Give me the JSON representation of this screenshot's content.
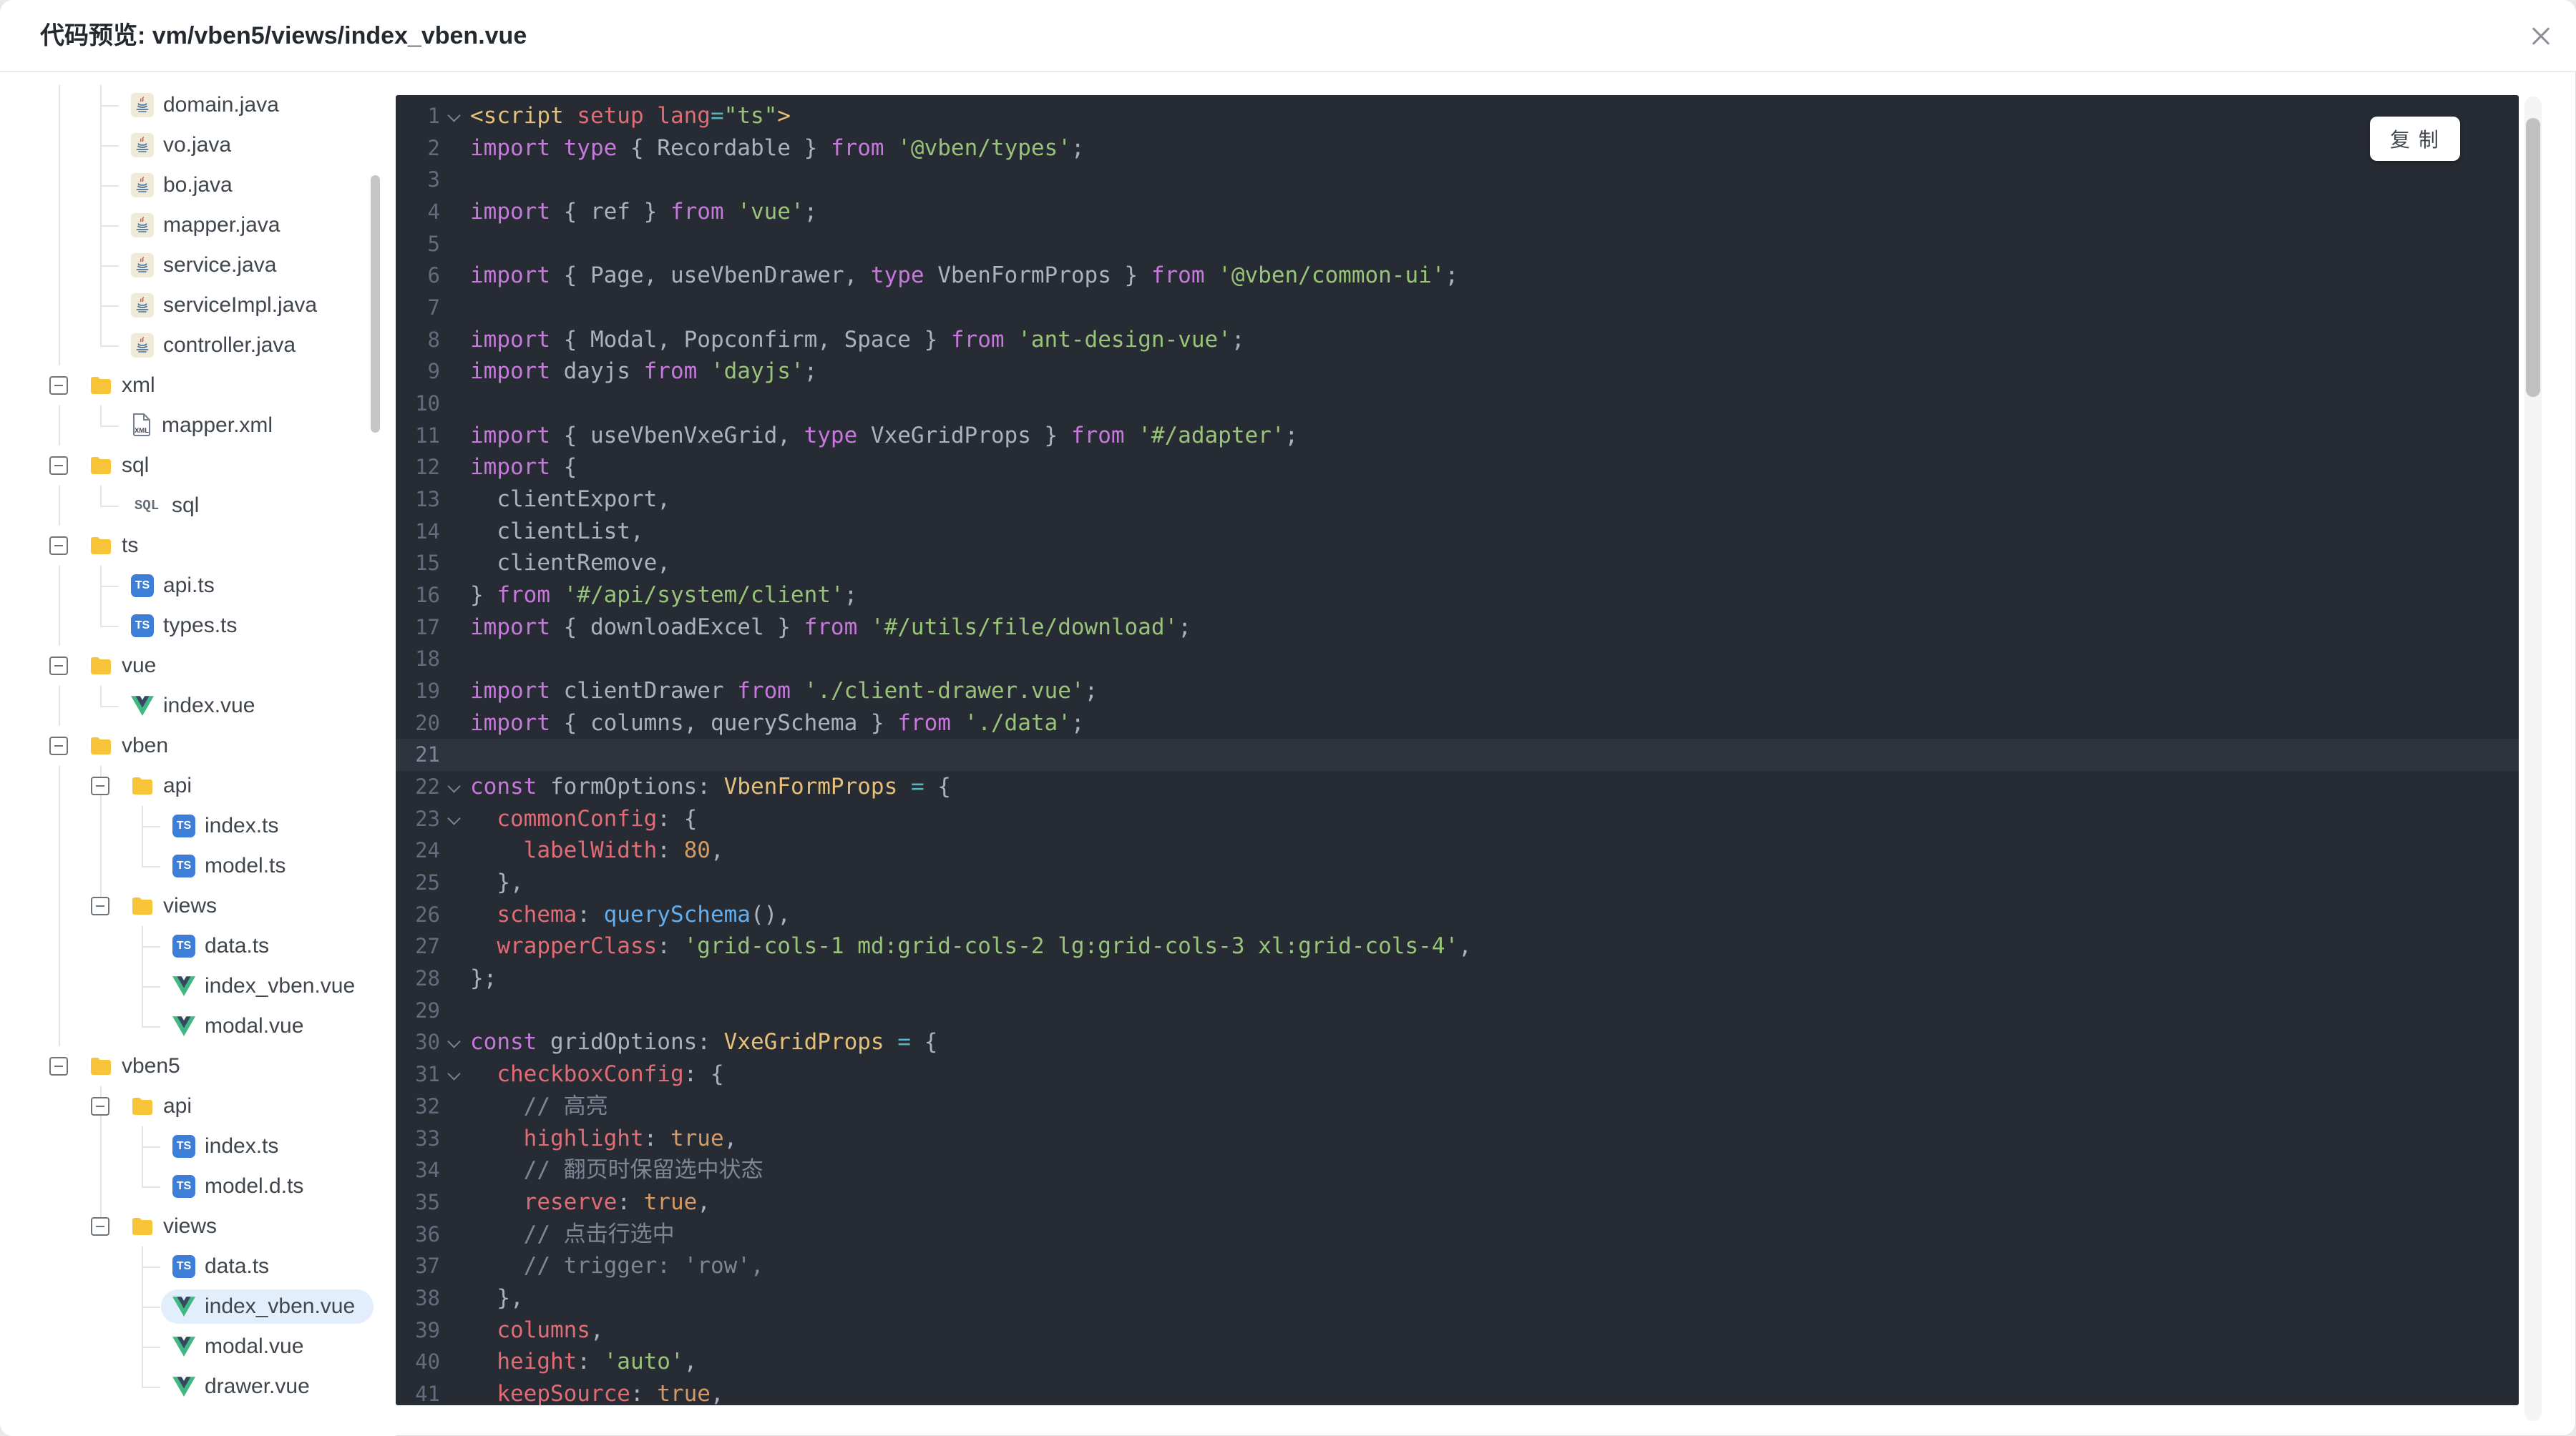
{
  "window": {
    "title": "代码预览: vm/vben5/views/index_vben.vue"
  },
  "toolbar": {
    "copy_label": "复 制"
  },
  "colors": {
    "code_background": "#272b33",
    "active_line": "#2f333d",
    "keyword": "#c678dd",
    "string": "#98c379",
    "type": "#e5c07b",
    "property": "#e06c75",
    "number_bool": "#d19a66",
    "operator": "#56b6c2",
    "function": "#61afef",
    "comment": "#7d8694",
    "foreground": "#abb2bf",
    "selected_item_bg": "#e2eefb",
    "folder_icon": "#f8c53a",
    "ts_icon_bg": "#3d7ed8",
    "vue_icon_green": "#41b883",
    "vue_icon_dark": "#35495e"
  },
  "sidebar": {
    "tree": [
      {
        "label": "domain.java",
        "icon": "java",
        "depth": 1,
        "expander": false,
        "elbow": "mid",
        "tick": true,
        "guides": [
          0
        ],
        "selected": false
      },
      {
        "label": "vo.java",
        "icon": "java",
        "depth": 1,
        "expander": false,
        "elbow": "mid",
        "tick": true,
        "guides": [
          0
        ],
        "selected": false
      },
      {
        "label": "bo.java",
        "icon": "java",
        "depth": 1,
        "expander": false,
        "elbow": "mid",
        "tick": true,
        "guides": [
          0
        ],
        "selected": false
      },
      {
        "label": "mapper.java",
        "icon": "java",
        "depth": 1,
        "expander": false,
        "elbow": "mid",
        "tick": true,
        "guides": [
          0
        ],
        "selected": false
      },
      {
        "label": "service.java",
        "icon": "java",
        "depth": 1,
        "expander": false,
        "elbow": "mid",
        "tick": true,
        "guides": [
          0
        ],
        "selected": false
      },
      {
        "label": "serviceImpl.java",
        "icon": "java",
        "depth": 1,
        "expander": false,
        "elbow": "mid",
        "tick": true,
        "guides": [
          0
        ],
        "selected": false
      },
      {
        "label": "controller.java",
        "icon": "java",
        "depth": 1,
        "expander": false,
        "elbow": "end",
        "tick": true,
        "guides": [
          0
        ],
        "selected": false
      },
      {
        "label": "xml",
        "icon": "folder",
        "depth": 0,
        "expander": true,
        "elbow": null,
        "tick": false,
        "guides": [],
        "selected": false
      },
      {
        "label": "mapper.xml",
        "icon": "xml",
        "depth": 1,
        "expander": false,
        "elbow": "end",
        "tick": true,
        "guides": [
          0
        ],
        "selected": false
      },
      {
        "label": "sql",
        "icon": "folder",
        "depth": 0,
        "expander": true,
        "elbow": null,
        "tick": false,
        "guides": [],
        "selected": false
      },
      {
        "label": "sql",
        "icon": "sql",
        "depth": 1,
        "expander": false,
        "elbow": "end",
        "tick": true,
        "guides": [
          0
        ],
        "selected": false
      },
      {
        "label": "ts",
        "icon": "folder",
        "depth": 0,
        "expander": true,
        "elbow": null,
        "tick": false,
        "guides": [],
        "selected": false
      },
      {
        "label": "api.ts",
        "icon": "ts",
        "depth": 1,
        "expander": false,
        "elbow": "mid",
        "tick": true,
        "guides": [
          0
        ],
        "selected": false
      },
      {
        "label": "types.ts",
        "icon": "ts",
        "depth": 1,
        "expander": false,
        "elbow": "end",
        "tick": true,
        "guides": [
          0
        ],
        "selected": false
      },
      {
        "label": "vue",
        "icon": "folder",
        "depth": 0,
        "expander": true,
        "elbow": null,
        "tick": false,
        "guides": [],
        "selected": false
      },
      {
        "label": "index.vue",
        "icon": "vue",
        "depth": 1,
        "expander": false,
        "elbow": "end",
        "tick": true,
        "guides": [
          0
        ],
        "selected": false
      },
      {
        "label": "vben",
        "icon": "folder",
        "depth": 0,
        "expander": true,
        "elbow": null,
        "tick": false,
        "guides": [],
        "selected": false
      },
      {
        "label": "api",
        "icon": "folder",
        "depth": 1,
        "expander": true,
        "elbow": "mid",
        "tick": false,
        "guides": [
          0
        ],
        "selected": false
      },
      {
        "label": "index.ts",
        "icon": "ts",
        "depth": 2,
        "expander": false,
        "elbow": "mid",
        "tick": true,
        "guides": [
          0,
          1
        ],
        "selected": false
      },
      {
        "label": "model.ts",
        "icon": "ts",
        "depth": 2,
        "expander": false,
        "elbow": "end",
        "tick": true,
        "guides": [
          0,
          1
        ],
        "selected": false
      },
      {
        "label": "views",
        "icon": "folder",
        "depth": 1,
        "expander": true,
        "elbow": "end",
        "tick": false,
        "guides": [
          0
        ],
        "selected": false
      },
      {
        "label": "data.ts",
        "icon": "ts",
        "depth": 2,
        "expander": false,
        "elbow": "mid",
        "tick": true,
        "guides": [
          0
        ],
        "selected": false
      },
      {
        "label": "index_vben.vue",
        "icon": "vue",
        "depth": 2,
        "expander": false,
        "elbow": "mid",
        "tick": true,
        "guides": [
          0
        ],
        "selected": false
      },
      {
        "label": "modal.vue",
        "icon": "vue",
        "depth": 2,
        "expander": false,
        "elbow": "end",
        "tick": true,
        "guides": [
          0
        ],
        "selected": false
      },
      {
        "label": "vben5",
        "icon": "folder",
        "depth": 0,
        "expander": true,
        "elbow": null,
        "tick": false,
        "guides": [],
        "selected": false
      },
      {
        "label": "api",
        "icon": "folder",
        "depth": 1,
        "expander": true,
        "elbow": "mid",
        "tick": false,
        "guides": [],
        "selected": false
      },
      {
        "label": "index.ts",
        "icon": "ts",
        "depth": 2,
        "expander": false,
        "elbow": "mid",
        "tick": true,
        "guides": [
          1
        ],
        "selected": false
      },
      {
        "label": "model.d.ts",
        "icon": "ts",
        "depth": 2,
        "expander": false,
        "elbow": "end",
        "tick": true,
        "guides": [
          1
        ],
        "selected": false
      },
      {
        "label": "views",
        "icon": "folder",
        "depth": 1,
        "expander": true,
        "elbow": "end",
        "tick": false,
        "guides": [],
        "selected": false
      },
      {
        "label": "data.ts",
        "icon": "ts",
        "depth": 2,
        "expander": false,
        "elbow": "mid",
        "tick": true,
        "guides": [],
        "selected": false
      },
      {
        "label": "index_vben.vue",
        "icon": "vue",
        "depth": 2,
        "expander": false,
        "elbow": "mid",
        "tick": true,
        "guides": [],
        "selected": true
      },
      {
        "label": "modal.vue",
        "icon": "vue",
        "depth": 2,
        "expander": false,
        "elbow": "mid",
        "tick": true,
        "guides": [],
        "selected": false
      },
      {
        "label": "drawer.vue",
        "icon": "vue",
        "depth": 2,
        "expander": false,
        "elbow": "end",
        "tick": true,
        "guides": [],
        "selected": false
      }
    ]
  },
  "code": {
    "language": "vue-ts",
    "active_line": 21,
    "fold_lines": [
      1,
      22,
      23,
      30,
      31
    ],
    "lines": [
      {
        "n": 1,
        "t": [
          [
            "<script",
            "typ"
          ],
          [
            " setup",
            "attr"
          ],
          [
            " lang",
            "attr"
          ],
          [
            "=",
            "op"
          ],
          [
            "\"ts\"",
            "str"
          ],
          [
            ">",
            "typ"
          ]
        ]
      },
      {
        "n": 2,
        "t": [
          [
            "import type",
            "kw"
          ],
          [
            " { Recordable } ",
            "fg"
          ],
          [
            "from",
            "kw"
          ],
          [
            " '@vben/types'",
            "str"
          ],
          [
            ";",
            "fg"
          ]
        ]
      },
      {
        "n": 3,
        "t": []
      },
      {
        "n": 4,
        "t": [
          [
            "import",
            "kw"
          ],
          [
            " { ref } ",
            "fg"
          ],
          [
            "from",
            "kw"
          ],
          [
            " 'vue'",
            "str"
          ],
          [
            ";",
            "fg"
          ]
        ]
      },
      {
        "n": 5,
        "t": []
      },
      {
        "n": 6,
        "t": [
          [
            "import",
            "kw"
          ],
          [
            " { Page, useVbenDrawer, ",
            "fg"
          ],
          [
            "type",
            "kw"
          ],
          [
            " VbenFormProps } ",
            "fg"
          ],
          [
            "from",
            "kw"
          ],
          [
            " '@vben/common-ui'",
            "str"
          ],
          [
            ";",
            "fg"
          ]
        ]
      },
      {
        "n": 7,
        "t": []
      },
      {
        "n": 8,
        "t": [
          [
            "import",
            "kw"
          ],
          [
            " { Modal, Popconfirm, Space } ",
            "fg"
          ],
          [
            "from",
            "kw"
          ],
          [
            " 'ant-design-vue'",
            "str"
          ],
          [
            ";",
            "fg"
          ]
        ]
      },
      {
        "n": 9,
        "t": [
          [
            "import",
            "kw"
          ],
          [
            " dayjs ",
            "fg"
          ],
          [
            "from",
            "kw"
          ],
          [
            " 'dayjs'",
            "str"
          ],
          [
            ";",
            "fg"
          ]
        ]
      },
      {
        "n": 10,
        "t": []
      },
      {
        "n": 11,
        "t": [
          [
            "import",
            "kw"
          ],
          [
            " { useVbenVxeGrid, ",
            "fg"
          ],
          [
            "type",
            "kw"
          ],
          [
            " VxeGridProps } ",
            "fg"
          ],
          [
            "from",
            "kw"
          ],
          [
            " '#/adapter'",
            "str"
          ],
          [
            ";",
            "fg"
          ]
        ]
      },
      {
        "n": 12,
        "t": [
          [
            "import",
            "kw"
          ],
          [
            " {",
            "fg"
          ]
        ]
      },
      {
        "n": 13,
        "t": [
          [
            "  clientExport,",
            "fg"
          ]
        ]
      },
      {
        "n": 14,
        "t": [
          [
            "  clientList,",
            "fg"
          ]
        ]
      },
      {
        "n": 15,
        "t": [
          [
            "  clientRemove,",
            "fg"
          ]
        ]
      },
      {
        "n": 16,
        "t": [
          [
            "} ",
            "fg"
          ],
          [
            "from",
            "kw"
          ],
          [
            " '#/api/system/client'",
            "str"
          ],
          [
            ";",
            "fg"
          ]
        ]
      },
      {
        "n": 17,
        "t": [
          [
            "import",
            "kw"
          ],
          [
            " { downloadExcel } ",
            "fg"
          ],
          [
            "from",
            "kw"
          ],
          [
            " '#/utils/file/download'",
            "str"
          ],
          [
            ";",
            "fg"
          ]
        ]
      },
      {
        "n": 18,
        "t": []
      },
      {
        "n": 19,
        "t": [
          [
            "import",
            "kw"
          ],
          [
            " clientDrawer ",
            "fg"
          ],
          [
            "from",
            "kw"
          ],
          [
            " './client-drawer.vue'",
            "str"
          ],
          [
            ";",
            "fg"
          ]
        ]
      },
      {
        "n": 20,
        "t": [
          [
            "import",
            "kw"
          ],
          [
            " { columns, querySchema } ",
            "fg"
          ],
          [
            "from",
            "kw"
          ],
          [
            " './data'",
            "str"
          ],
          [
            ";",
            "fg"
          ]
        ]
      },
      {
        "n": 21,
        "t": []
      },
      {
        "n": 22,
        "t": [
          [
            "const",
            "kw"
          ],
          [
            " formOptions",
            "fg"
          ],
          [
            ": ",
            "fg"
          ],
          [
            "VbenFormProps",
            "typ"
          ],
          [
            " ",
            "fg"
          ],
          [
            "=",
            "op"
          ],
          [
            " {",
            "fg"
          ]
        ]
      },
      {
        "n": 23,
        "t": [
          [
            "  commonConfig",
            "prop"
          ],
          [
            ": {",
            "fg"
          ]
        ]
      },
      {
        "n": 24,
        "t": [
          [
            "    labelWidth",
            "prop"
          ],
          [
            ": ",
            "fg"
          ],
          [
            "80",
            "num"
          ],
          [
            ",",
            "fg"
          ]
        ]
      },
      {
        "n": 25,
        "t": [
          [
            "  },",
            "fg"
          ]
        ]
      },
      {
        "n": 26,
        "t": [
          [
            "  schema",
            "prop"
          ],
          [
            ": ",
            "fg"
          ],
          [
            "querySchema",
            "fn"
          ],
          [
            "(),",
            "fg"
          ]
        ]
      },
      {
        "n": 27,
        "t": [
          [
            "  wrapperClass",
            "prop"
          ],
          [
            ": ",
            "fg"
          ],
          [
            "'grid-cols-1 md:grid-cols-2 lg:grid-cols-3 xl:grid-cols-4'",
            "str"
          ],
          [
            ",",
            "fg"
          ]
        ]
      },
      {
        "n": 28,
        "t": [
          [
            "};",
            "fg"
          ]
        ]
      },
      {
        "n": 29,
        "t": []
      },
      {
        "n": 30,
        "t": [
          [
            "const",
            "kw"
          ],
          [
            " gridOptions",
            "fg"
          ],
          [
            ": ",
            "fg"
          ],
          [
            "VxeGridProps",
            "typ"
          ],
          [
            " ",
            "fg"
          ],
          [
            "=",
            "op"
          ],
          [
            " {",
            "fg"
          ]
        ]
      },
      {
        "n": 31,
        "t": [
          [
            "  checkboxConfig",
            "prop"
          ],
          [
            ": {",
            "fg"
          ]
        ]
      },
      {
        "n": 32,
        "t": [
          [
            "    // 高亮",
            "com"
          ]
        ]
      },
      {
        "n": 33,
        "t": [
          [
            "    highlight",
            "prop"
          ],
          [
            ": ",
            "fg"
          ],
          [
            "true",
            "num"
          ],
          [
            ",",
            "fg"
          ]
        ]
      },
      {
        "n": 34,
        "t": [
          [
            "    // 翻页时保留选中状态",
            "com"
          ]
        ]
      },
      {
        "n": 35,
        "t": [
          [
            "    reserve",
            "prop"
          ],
          [
            ": ",
            "fg"
          ],
          [
            "true",
            "num"
          ],
          [
            ",",
            "fg"
          ]
        ]
      },
      {
        "n": 36,
        "t": [
          [
            "    // 点击行选中",
            "com"
          ]
        ]
      },
      {
        "n": 37,
        "t": [
          [
            "    // trigger: 'row',",
            "com"
          ]
        ]
      },
      {
        "n": 38,
        "t": [
          [
            "  },",
            "fg"
          ]
        ]
      },
      {
        "n": 39,
        "t": [
          [
            "  columns",
            "prop"
          ],
          [
            ",",
            "fg"
          ]
        ]
      },
      {
        "n": 40,
        "t": [
          [
            "  height",
            "prop"
          ],
          [
            ": ",
            "fg"
          ],
          [
            "'auto'",
            "str"
          ],
          [
            ",",
            "fg"
          ]
        ]
      },
      {
        "n": 41,
        "t": [
          [
            "  keepSource",
            "prop"
          ],
          [
            ": ",
            "fg"
          ],
          [
            "true",
            "num"
          ],
          [
            ",",
            "fg"
          ]
        ]
      }
    ]
  }
}
